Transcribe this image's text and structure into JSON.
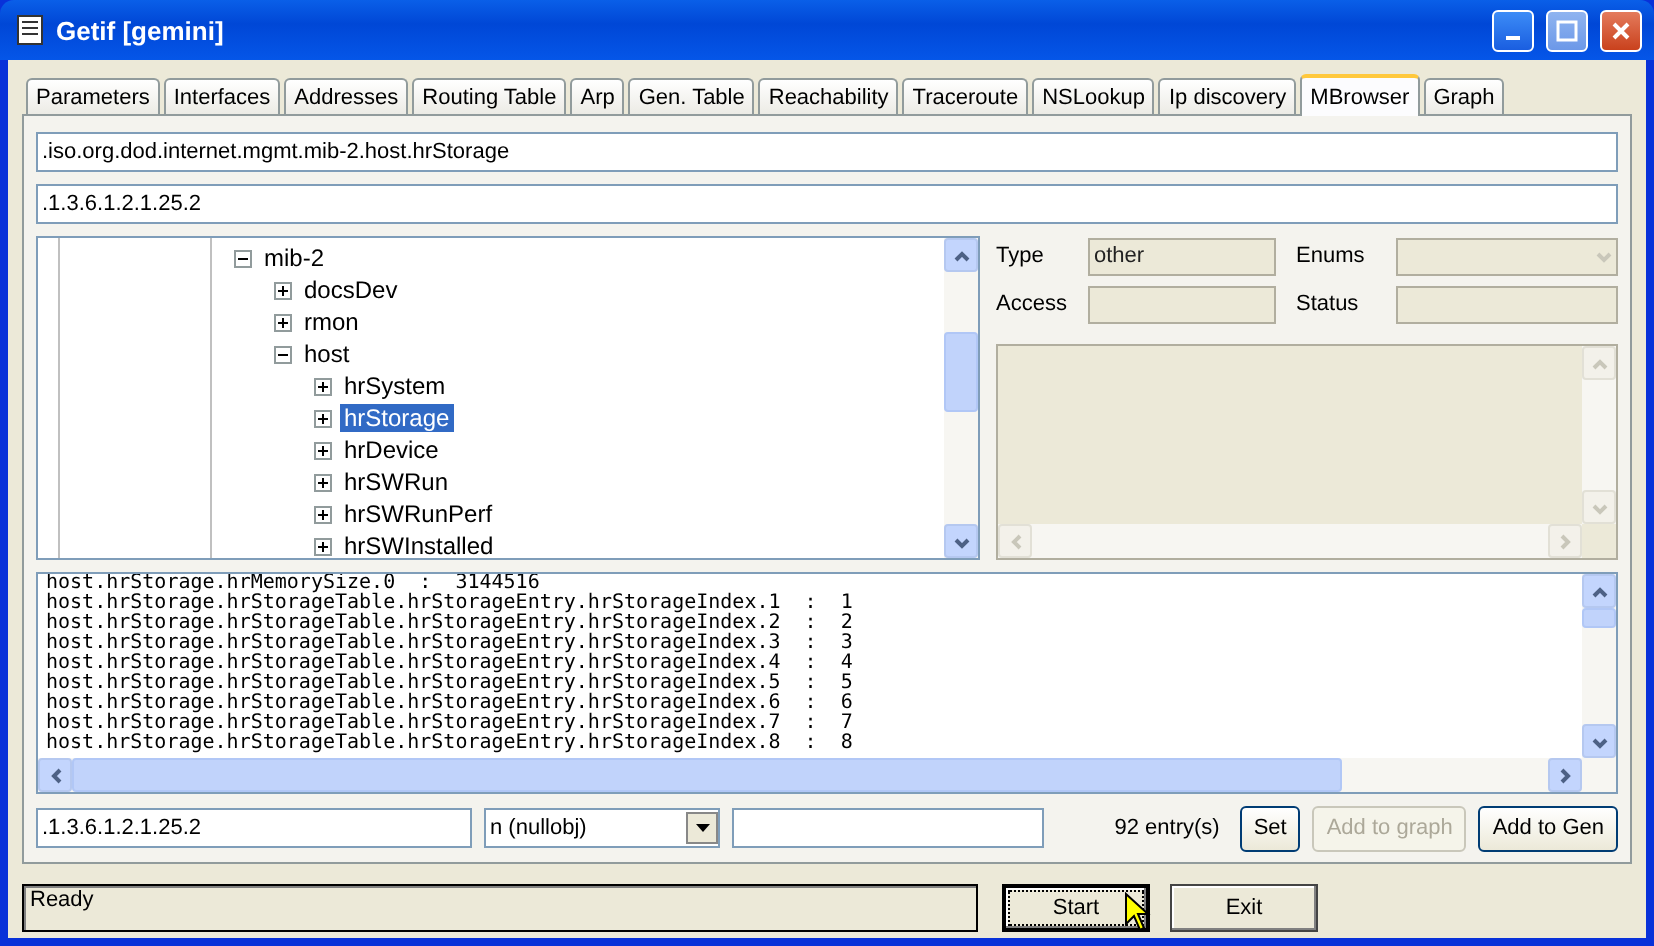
{
  "window": {
    "title": "Getif [gemini]"
  },
  "tabs": [
    {
      "label": "Parameters",
      "selected": false
    },
    {
      "label": "Interfaces",
      "selected": false
    },
    {
      "label": "Addresses",
      "selected": false
    },
    {
      "label": "Routing Table",
      "selected": false
    },
    {
      "label": "Arp",
      "selected": false
    },
    {
      "label": "Gen. Table",
      "selected": false
    },
    {
      "label": "Reachability",
      "selected": false
    },
    {
      "label": "Traceroute",
      "selected": false
    },
    {
      "label": "NSLookup",
      "selected": false
    },
    {
      "label": "Ip discovery",
      "selected": false
    },
    {
      "label": "MBrowser",
      "selected": true
    },
    {
      "label": "Graph",
      "selected": false
    }
  ],
  "mbrowser": {
    "oid_name": ".iso.org.dod.internet.mgmt.mib-2.host.hrStorage",
    "oid": ".1.3.6.1.2.1.25.2",
    "tree": [
      {
        "label": "mib-2",
        "expanded": true,
        "selected": false,
        "children": [
          {
            "label": "docsDev",
            "expanded": false,
            "selected": false
          },
          {
            "label": "rmon",
            "expanded": false,
            "selected": false
          },
          {
            "label": "host",
            "expanded": true,
            "selected": false,
            "children": [
              {
                "label": "hrSystem",
                "expanded": false,
                "selected": false
              },
              {
                "label": "hrStorage",
                "expanded": false,
                "selected": true
              },
              {
                "label": "hrDevice",
                "expanded": false,
                "selected": false
              },
              {
                "label": "hrSWRun",
                "expanded": false,
                "selected": false
              },
              {
                "label": "hrSWRunPerf",
                "expanded": false,
                "selected": false
              },
              {
                "label": "hrSWInstalled",
                "expanded": false,
                "selected": false
              }
            ]
          }
        ]
      }
    ],
    "details": {
      "type_label": "Type",
      "type_value": "other",
      "enums_label": "Enums",
      "access_label": "Access",
      "status_label": "Status"
    },
    "results": [
      "host.hrStorage.hrMemorySize.0  :  3144516",
      "host.hrStorage.hrStorageTable.hrStorageEntry.hrStorageIndex.1  :  1",
      "host.hrStorage.hrStorageTable.hrStorageEntry.hrStorageIndex.2  :  2",
      "host.hrStorage.hrStorageTable.hrStorageEntry.hrStorageIndex.3  :  3",
      "host.hrStorage.hrStorageTable.hrStorageEntry.hrStorageIndex.4  :  4",
      "host.hrStorage.hrStorageTable.hrStorageEntry.hrStorageIndex.5  :  5",
      "host.hrStorage.hrStorageTable.hrStorageEntry.hrStorageIndex.6  :  6",
      "host.hrStorage.hrStorageTable.hrStorageEntry.hrStorageIndex.7  :  7",
      "host.hrStorage.hrStorageTable.hrStorageEntry.hrStorageIndex.8  :  8"
    ],
    "set_oid": ".1.3.6.1.2.1.25.2",
    "set_type": "n (nullobj)",
    "entry_count": "92 entry(s)",
    "buttons": [
      {
        "label": "Set",
        "disabled": false
      },
      {
        "label": "Add to graph",
        "disabled": true
      },
      {
        "label": "Add to Gen",
        "disabled": false
      }
    ]
  },
  "status_bar": {
    "text": "Ready"
  },
  "actions": [
    {
      "label": "Start",
      "focused": true
    },
    {
      "label": "Exit",
      "focused": false
    }
  ]
}
